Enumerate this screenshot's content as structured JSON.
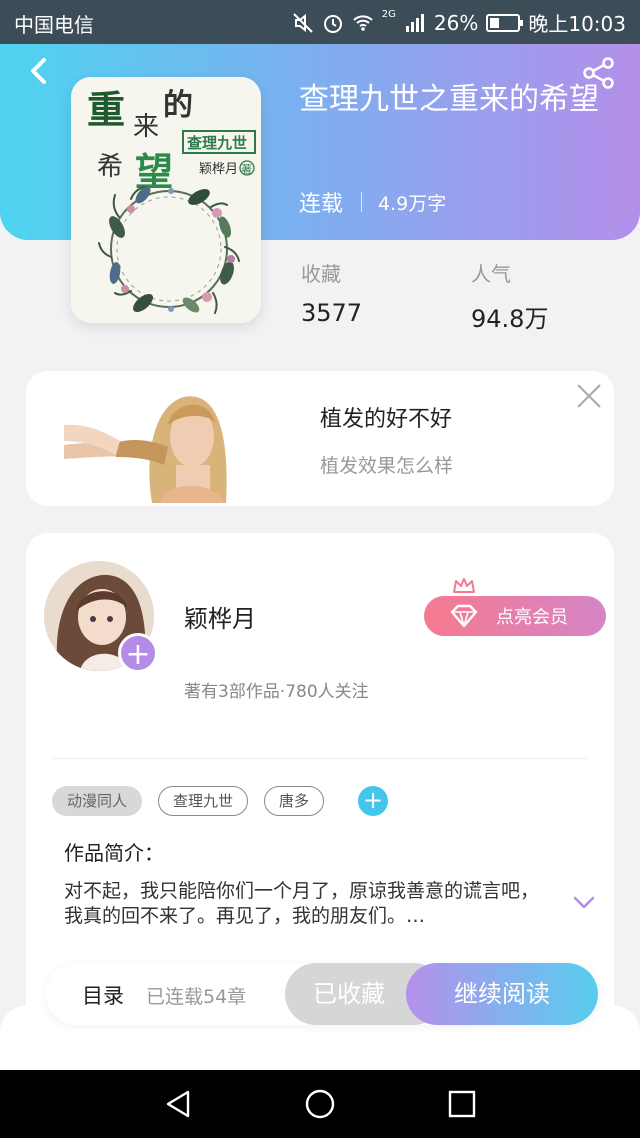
{
  "status_bar": {
    "carrier": "中国电信",
    "network": "2G",
    "battery": "26%",
    "time": "晚上10:03"
  },
  "book": {
    "title": "查理九世之重来的希望",
    "status": "连载",
    "word_count": "4.9万字",
    "cover_text": {
      "chars": [
        "重",
        "来",
        "的",
        "希",
        "望"
      ],
      "series": "查理九世",
      "author": "颖桦月",
      "author_mark": "著"
    }
  },
  "stats": {
    "favorites_label": "收藏",
    "favorites_value": "3577",
    "popularity_label": "人气",
    "popularity_value": "94.8万"
  },
  "ad": {
    "title": "植发的好不好",
    "subtitle": "植发效果怎么样"
  },
  "author": {
    "name": "颖桦月",
    "info": "著有3部作品·780人关注",
    "vip_button": "点亮会员"
  },
  "tags": [
    "动漫同人",
    "查理九世",
    "唐多"
  ],
  "intro": {
    "label": "作品简介：",
    "text": "对不起，我只能陪你们一个月了，原谅我善意的谎言吧，我真的回不来了。再见了，我的朋友们。…"
  },
  "actions": {
    "toc": "目录",
    "chapters": "已连载54章",
    "collected": "已收藏",
    "continue": "继续阅读"
  },
  "colors": {
    "header_gradient_start": "#4ed4f0",
    "header_gradient_end": "#b48fea",
    "vip_gradient_start": "#f47a8e",
    "vip_gradient_end": "#d685c8",
    "accent_purple": "#b58be8",
    "accent_cyan": "#44c6ec"
  },
  "icons": [
    "back-icon",
    "share-icon",
    "close-icon",
    "add-icon",
    "diamond-icon",
    "crown-icon",
    "chevron-down-icon",
    "nav-back-icon",
    "nav-home-icon",
    "nav-recents-icon"
  ]
}
